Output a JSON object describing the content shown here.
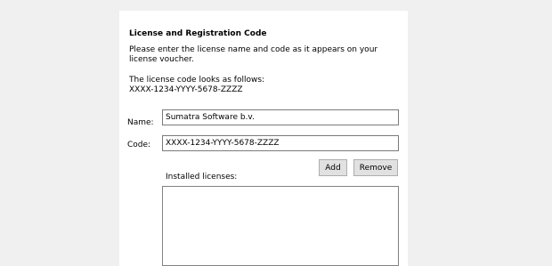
{
  "section": {
    "title": "License and Registration Code",
    "instructions": "Please enter the license name and code as it appears on your license voucher.",
    "format_intro": "The license code looks as follows:",
    "format_example": "XXXX-1234-YYYY-5678-ZZZZ"
  },
  "form": {
    "name_label": "Name:",
    "name_value": "Sumatra Software b.v.",
    "code_label": "Code:",
    "code_value": "XXXX-1234-YYYY-5678-ZZZZ"
  },
  "buttons": {
    "add_label": "Add",
    "remove_label": "Remove"
  },
  "licenses": {
    "label": "Installed licenses:",
    "items": []
  }
}
